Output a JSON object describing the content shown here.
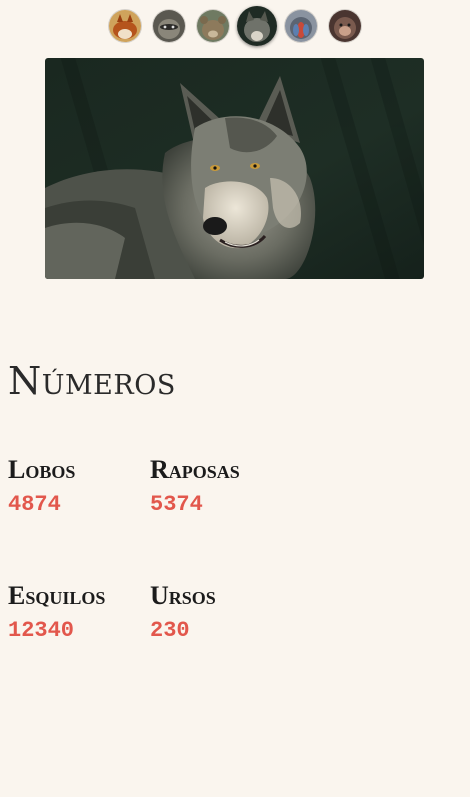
{
  "gallery": {
    "thumbnails": [
      {
        "name": "fox-thumbnail",
        "color": "#b86a2a",
        "active": false
      },
      {
        "name": "raccoon-thumbnail",
        "color": "#6e6a60",
        "active": false
      },
      {
        "name": "bear-thumbnail",
        "color": "#7b7564",
        "active": false
      },
      {
        "name": "wolf-thumbnail",
        "color": "#3e4a42",
        "active": true
      },
      {
        "name": "mandrill-thumbnail",
        "color": "#6f7b8c",
        "active": false
      },
      {
        "name": "monkey-thumbnail",
        "color": "#6b4d45",
        "active": false
      }
    ],
    "hero_subject": "wolf"
  },
  "stats": {
    "title": "Números",
    "items": [
      {
        "label": "Lobos",
        "value": "4874"
      },
      {
        "label": "Raposas",
        "value": "5374"
      },
      {
        "label": "Esquilos",
        "value": "12340"
      },
      {
        "label": "Ursos",
        "value": "230"
      }
    ],
    "value_color": "#e2574c"
  },
  "colors": {
    "background": "#faf5ee",
    "text": "#1b1b1b",
    "accent": "#e2574c"
  }
}
